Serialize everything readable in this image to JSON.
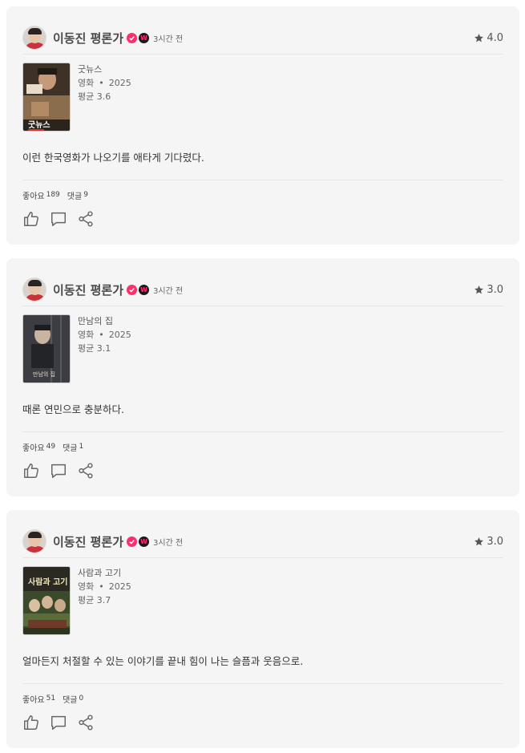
{
  "author": {
    "name": "이동진 평론가",
    "verified_icon": "check-badge-icon",
    "brand_badge_letter": "W"
  },
  "colors": {
    "badge_pink": "#ff2f6e",
    "card_bg": "#f5f5f5"
  },
  "reviews": [
    {
      "time": "3시간 전",
      "rating": "4.0",
      "movie": {
        "title": "굿뉴스",
        "type": "영화",
        "year": "2025",
        "average": "평균 3.6",
        "poster_caption": "굿뉴스"
      },
      "text": "이런 한국영화가 나오기를 애타게 기다렸다.",
      "likes_label": "좋아요",
      "likes": "189",
      "comments_label": "댓글",
      "comments": "9"
    },
    {
      "time": "3시간 전",
      "rating": "3.0",
      "movie": {
        "title": "만남의 집",
        "type": "영화",
        "year": "2025",
        "average": "평균 3.1",
        "poster_caption": "만남의 집"
      },
      "text": "때론 연민으로 충분하다.",
      "likes_label": "좋아요",
      "likes": "49",
      "comments_label": "댓글",
      "comments": "1"
    },
    {
      "time": "3시간 전",
      "rating": "3.0",
      "movie": {
        "title": "사람과 고기",
        "type": "영화",
        "year": "2025",
        "average": "평균 3.7",
        "poster_caption": "사람과 고기"
      },
      "text": "얼마든지 처절할 수 있는 이야기를 끝내 힘이 나는 슬픔과 웃음으로.",
      "likes_label": "좋아요",
      "likes": "51",
      "comments_label": "댓글",
      "comments": "0"
    }
  ],
  "action_icons": [
    "thumbs-up-icon",
    "comment-icon",
    "share-icon"
  ]
}
